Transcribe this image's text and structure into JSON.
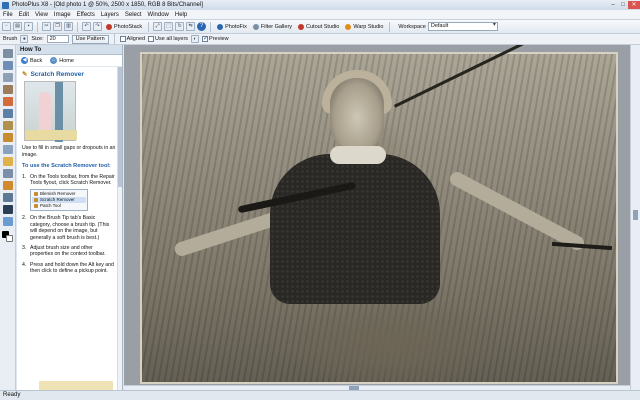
{
  "window": {
    "title": "PhotoPlus X8 - [Old photo 1 @ 50%, 2500 x 1850, RGB 8 Bits/Channel]",
    "minimize": "–",
    "maximize": "□",
    "close": "✕"
  },
  "menu": [
    "File",
    "Edit",
    "View",
    "Image",
    "Effects",
    "Layers",
    "Select",
    "Window",
    "Help"
  ],
  "toolbar": {
    "photostack": "PhotoStack",
    "photofix": "PhotoFix",
    "filter_gallery": "Filter Gallery",
    "cutout_studio": "Cutout Studio",
    "warp_studio": "Warp Studio",
    "workspace_label": "Workspace",
    "workspace_value": "Default",
    "help": "?"
  },
  "context_toolbar": {
    "brush_label": "Brush",
    "size_label": "Size:",
    "size_value": "20",
    "use_pattern": "Use Pattern",
    "aligned": "Aligned",
    "use_all_layers": "Use all layers",
    "preview": "Preview",
    "preview_checked": true
  },
  "howto": {
    "header": "How To",
    "back": "Back",
    "home": "Home",
    "title": "Scratch Remover",
    "intro": "Use to fill in small gaps or dropouts in an image.",
    "section": "To use the Scratch Remover tool:",
    "steps": [
      "On the Tools toolbar, from the Repair Tools flyout, click Scratch Remover.",
      "On the Brush Tip tab's Basic category, choose a brush tip. (This will depend on the image, but generally a soft brush is best.)",
      "Adjust brush size and other properties on the context toolbar.",
      "Press and hold down the Alt key and then click to define a pickup point."
    ],
    "flyout": [
      "Blemish Remover",
      "Scratch Remover",
      "Patch Tool"
    ]
  },
  "status": {
    "text": "Ready"
  },
  "colors": {
    "accent": "#1f5fa8",
    "title_bar": "#cfdbe9",
    "close_button": "#d9534f"
  }
}
